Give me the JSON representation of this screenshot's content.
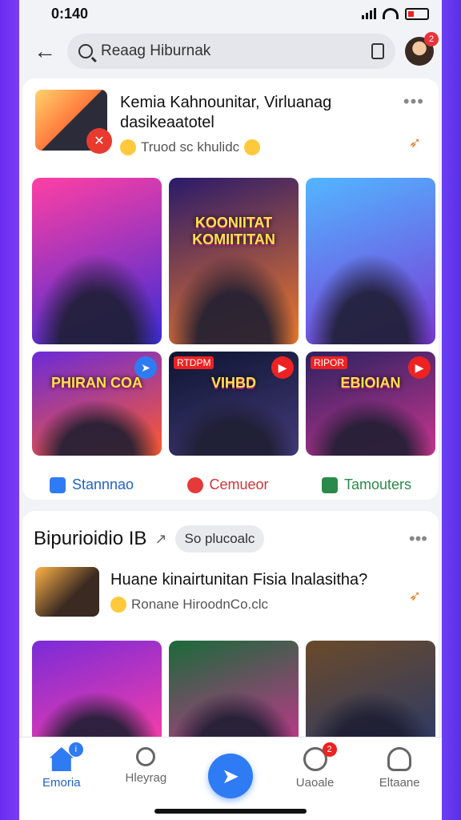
{
  "status_bar": {
    "time": "0:140"
  },
  "header": {
    "search_text": "Reaag Hiburnak",
    "profile_badge": "2"
  },
  "post1": {
    "title": "Kemia Kahnounitar, Virluanag dasikeaatotel",
    "subtitle": "Truod sc khulidc",
    "tiles": [
      {
        "label": "",
        "tag": "",
        "colors": [
          "#ff3fa4",
          "#3b2bd6"
        ]
      },
      {
        "label": "KOONIITAT KOMIITITAN",
        "tag": "",
        "colors": [
          "#2a1a6a",
          "#f07a2a"
        ]
      },
      {
        "label": "",
        "tag": "",
        "colors": [
          "#52b6ff",
          "#7a38d8"
        ]
      },
      {
        "label": "PHIRAN COA",
        "tag": "",
        "colors": [
          "#6b2bd8",
          "#ff5a2e"
        ],
        "corner": "blue"
      },
      {
        "label": "VIHBD",
        "tag": "RTDPM",
        "colors": [
          "#0d1530",
          "#443a7a"
        ],
        "corner": "red"
      },
      {
        "label": "EBIOIAN",
        "tag": "RIPOR",
        "colors": [
          "#2a2260",
          "#c8358f"
        ],
        "corner": "red"
      }
    ],
    "actions": [
      {
        "label": "Stannnao",
        "icon": "like-icon"
      },
      {
        "label": "Cemueor",
        "icon": "heart-icon"
      },
      {
        "label": "Tamouters",
        "icon": "share-icon"
      }
    ]
  },
  "section2": {
    "title": "Bipurioidio IB",
    "chip": "So plucoalc",
    "post_title": "Huane kinairtunitan Fisia lnalasitha?",
    "post_subtitle": "Ronane HiroodnCo.clc",
    "tiles": [
      {
        "colors": [
          "#7a2bd8",
          "#ff3fa4"
        ]
      },
      {
        "colors": [
          "#1a6a3a",
          "#c8358f"
        ]
      },
      {
        "colors": [
          "#6a4a2a",
          "#2a3a6a"
        ]
      }
    ]
  },
  "tabbar": {
    "tabs": [
      {
        "label": "Emoria",
        "badge": "i"
      },
      {
        "label": "Hleyrag",
        "badge": ""
      },
      {
        "label": "",
        "badge": ""
      },
      {
        "label": "Uaoale",
        "badge": "2"
      },
      {
        "label": "Eltaane",
        "badge": ""
      }
    ]
  }
}
